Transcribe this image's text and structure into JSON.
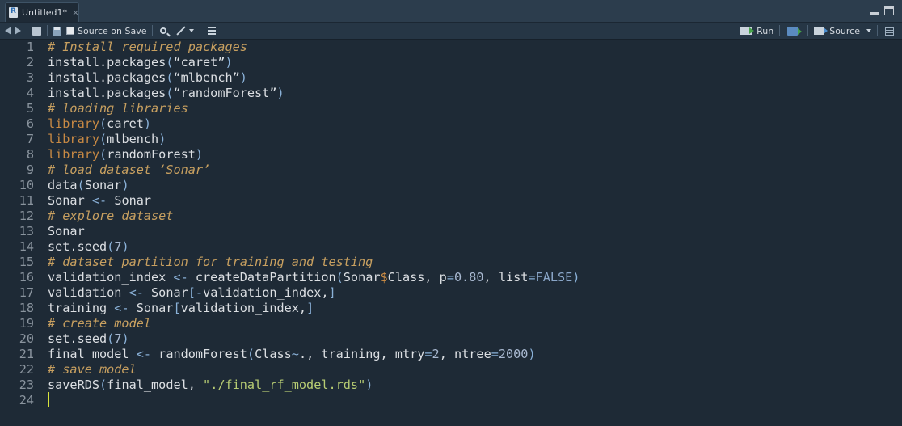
{
  "tab": {
    "title": "Untitled1*",
    "close": "×"
  },
  "toolbar": {
    "source_on_save": "Source on Save",
    "run": "Run",
    "source": "Source"
  },
  "editor": {
    "lines": [
      {
        "n": "1",
        "tokens": [
          {
            "t": "# Install required packages",
            "c": "c-comment"
          }
        ]
      },
      {
        "n": "2",
        "tokens": [
          {
            "t": "install.packages",
            "c": "c-fn"
          },
          {
            "t": "(",
            "c": "c-op"
          },
          {
            "t": "“caret”",
            "c": "c-str"
          },
          {
            "t": ")",
            "c": "c-op"
          }
        ]
      },
      {
        "n": "3",
        "tokens": [
          {
            "t": "install.packages",
            "c": "c-fn"
          },
          {
            "t": "(",
            "c": "c-op"
          },
          {
            "t": "“mlbench”",
            "c": "c-str"
          },
          {
            "t": ")",
            "c": "c-op"
          }
        ]
      },
      {
        "n": "4",
        "tokens": [
          {
            "t": "install.packages",
            "c": "c-fn"
          },
          {
            "t": "(",
            "c": "c-op"
          },
          {
            "t": "“randomForest”",
            "c": "c-str"
          },
          {
            "t": ")",
            "c": "c-op"
          }
        ]
      },
      {
        "n": "5",
        "tokens": [
          {
            "t": "# loading libraries",
            "c": "c-comment"
          }
        ]
      },
      {
        "n": "6",
        "tokens": [
          {
            "t": "library",
            "c": "c-kw"
          },
          {
            "t": "(",
            "c": "c-op"
          },
          {
            "t": "caret",
            "c": "c-id"
          },
          {
            "t": ")",
            "c": "c-op"
          }
        ]
      },
      {
        "n": "7",
        "tokens": [
          {
            "t": "library",
            "c": "c-kw"
          },
          {
            "t": "(",
            "c": "c-op"
          },
          {
            "t": "mlbench",
            "c": "c-id"
          },
          {
            "t": ")",
            "c": "c-op"
          }
        ]
      },
      {
        "n": "8",
        "tokens": [
          {
            "t": "library",
            "c": "c-kw"
          },
          {
            "t": "(",
            "c": "c-op"
          },
          {
            "t": "randomForest",
            "c": "c-id"
          },
          {
            "t": ")",
            "c": "c-op"
          }
        ]
      },
      {
        "n": "9",
        "tokens": [
          {
            "t": "# load dataset ‘Sonar’",
            "c": "c-comment"
          }
        ]
      },
      {
        "n": "10",
        "tokens": [
          {
            "t": "data",
            "c": "c-fn"
          },
          {
            "t": "(",
            "c": "c-op"
          },
          {
            "t": "Sonar",
            "c": "c-id"
          },
          {
            "t": ")",
            "c": "c-op"
          }
        ]
      },
      {
        "n": "11",
        "tokens": [
          {
            "t": "Sonar ",
            "c": "c-id"
          },
          {
            "t": "<-",
            "c": "c-op"
          },
          {
            "t": " Sonar",
            "c": "c-id"
          }
        ]
      },
      {
        "n": "12",
        "tokens": [
          {
            "t": "# explore dataset",
            "c": "c-comment"
          }
        ]
      },
      {
        "n": "13",
        "tokens": [
          {
            "t": "Sonar",
            "c": "c-id"
          }
        ]
      },
      {
        "n": "14",
        "tokens": [
          {
            "t": "set.seed",
            "c": "c-fn"
          },
          {
            "t": "(",
            "c": "c-op"
          },
          {
            "t": "7",
            "c": "c-num"
          },
          {
            "t": ")",
            "c": "c-op"
          }
        ]
      },
      {
        "n": "15",
        "tokens": [
          {
            "t": "# dataset partition for training and testing",
            "c": "c-comment"
          }
        ]
      },
      {
        "n": "16",
        "tokens": [
          {
            "t": "validation_index ",
            "c": "c-id"
          },
          {
            "t": "<-",
            "c": "c-op"
          },
          {
            "t": " createDataPartition",
            "c": "c-fn"
          },
          {
            "t": "(",
            "c": "c-op"
          },
          {
            "t": "Sonar",
            "c": "c-id"
          },
          {
            "t": "$",
            "c": "c-kw"
          },
          {
            "t": "Class, p",
            "c": "c-id"
          },
          {
            "t": "=",
            "c": "c-op"
          },
          {
            "t": "0.80",
            "c": "c-num"
          },
          {
            "t": ", list",
            "c": "c-id"
          },
          {
            "t": "=",
            "c": "c-op"
          },
          {
            "t": "FALSE",
            "c": "c-lit"
          },
          {
            "t": ")",
            "c": "c-op"
          }
        ]
      },
      {
        "n": "17",
        "tokens": [
          {
            "t": "validation ",
            "c": "c-id"
          },
          {
            "t": "<-",
            "c": "c-op"
          },
          {
            "t": " Sonar",
            "c": "c-id"
          },
          {
            "t": "[",
            "c": "c-op"
          },
          {
            "t": "-",
            "c": "c-op"
          },
          {
            "t": "validation_index,",
            "c": "c-id"
          },
          {
            "t": "]",
            "c": "c-op"
          }
        ]
      },
      {
        "n": "18",
        "tokens": [
          {
            "t": "training ",
            "c": "c-id"
          },
          {
            "t": "<-",
            "c": "c-op"
          },
          {
            "t": " Sonar",
            "c": "c-id"
          },
          {
            "t": "[",
            "c": "c-op"
          },
          {
            "t": "validation_index,",
            "c": "c-id"
          },
          {
            "t": "]",
            "c": "c-op"
          }
        ]
      },
      {
        "n": "19",
        "tokens": [
          {
            "t": "# create model",
            "c": "c-comment"
          }
        ]
      },
      {
        "n": "20",
        "tokens": [
          {
            "t": "set.seed",
            "c": "c-fn"
          },
          {
            "t": "(",
            "c": "c-op"
          },
          {
            "t": "7",
            "c": "c-num"
          },
          {
            "t": ")",
            "c": "c-op"
          }
        ]
      },
      {
        "n": "21",
        "tokens": [
          {
            "t": "final_model ",
            "c": "c-id"
          },
          {
            "t": "<-",
            "c": "c-op"
          },
          {
            "t": " randomForest",
            "c": "c-fn"
          },
          {
            "t": "(",
            "c": "c-op"
          },
          {
            "t": "Class",
            "c": "c-id"
          },
          {
            "t": "~",
            "c": "c-op"
          },
          {
            "t": "., training, mtry",
            "c": "c-id"
          },
          {
            "t": "=",
            "c": "c-op"
          },
          {
            "t": "2",
            "c": "c-num"
          },
          {
            "t": ", ntree",
            "c": "c-id"
          },
          {
            "t": "=",
            "c": "c-op"
          },
          {
            "t": "2000",
            "c": "c-num"
          },
          {
            "t": ")",
            "c": "c-op"
          }
        ]
      },
      {
        "n": "22",
        "tokens": [
          {
            "t": "# save model",
            "c": "c-comment"
          }
        ]
      },
      {
        "n": "23",
        "tokens": [
          {
            "t": "saveRDS",
            "c": "c-fn"
          },
          {
            "t": "(",
            "c": "c-op"
          },
          {
            "t": "final_model, ",
            "c": "c-id"
          },
          {
            "t": "\"./final_rf_model.rds\"",
            "c": "c-green"
          },
          {
            "t": ")",
            "c": "c-op"
          }
        ]
      },
      {
        "n": "24",
        "tokens": []
      }
    ]
  }
}
